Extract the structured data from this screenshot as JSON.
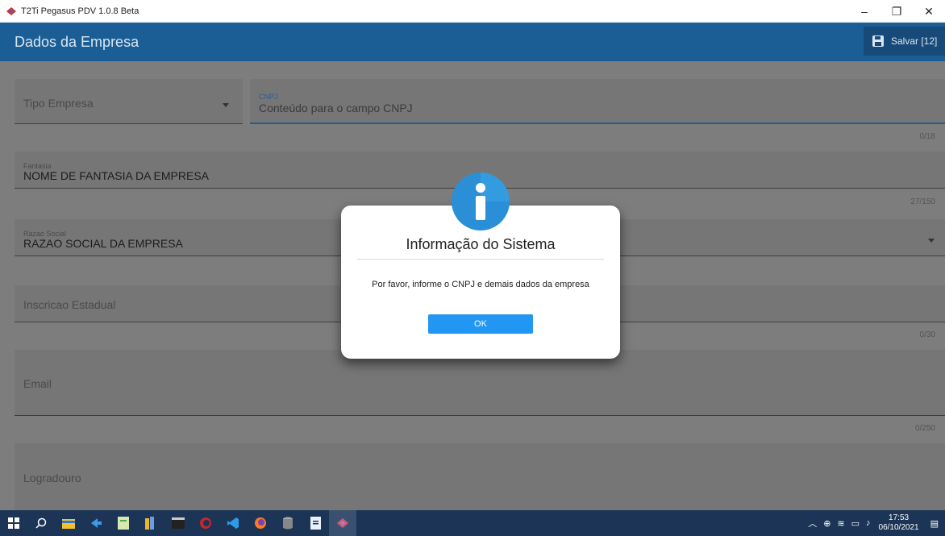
{
  "window": {
    "title": "T2Ti Pegasus PDV 1.0.8 Beta",
    "minimize": "–",
    "restore": "❐",
    "close": "✕"
  },
  "appbar": {
    "title": "Dados da Empresa",
    "save_label": "Salvar [12]"
  },
  "form": {
    "tipo_empresa": {
      "label": "Tipo Empresa"
    },
    "cnpj": {
      "label": "CNPJ",
      "placeholder": "Conteúdo para o campo CNPJ",
      "counter": "0/18"
    },
    "fantasia": {
      "label": "Fantasia",
      "value": "NOME DE FANTASIA DA EMPRESA",
      "counter": "27/150"
    },
    "razao_social": {
      "label": "Razao Social",
      "value": "RAZAO SOCIAL DA EMPRESA"
    },
    "inscricao_estadual": {
      "label": "Inscricao Estadual",
      "counter": "0/30"
    },
    "email": {
      "label": "Email",
      "counter": "0/250"
    },
    "logradouro": {
      "label": "Logradouro"
    }
  },
  "dialog": {
    "title": "Informação do Sistema",
    "message": "Por favor, informe o CNPJ e demais dados da empresa",
    "ok_label": "OK",
    "icon": "info-icon"
  },
  "taskbar": {
    "time": "17:53",
    "date": "06/10/2021"
  },
  "colors": {
    "appbar": "#1b5e95",
    "accent": "#2196f3",
    "taskbar": "#1c3556"
  }
}
